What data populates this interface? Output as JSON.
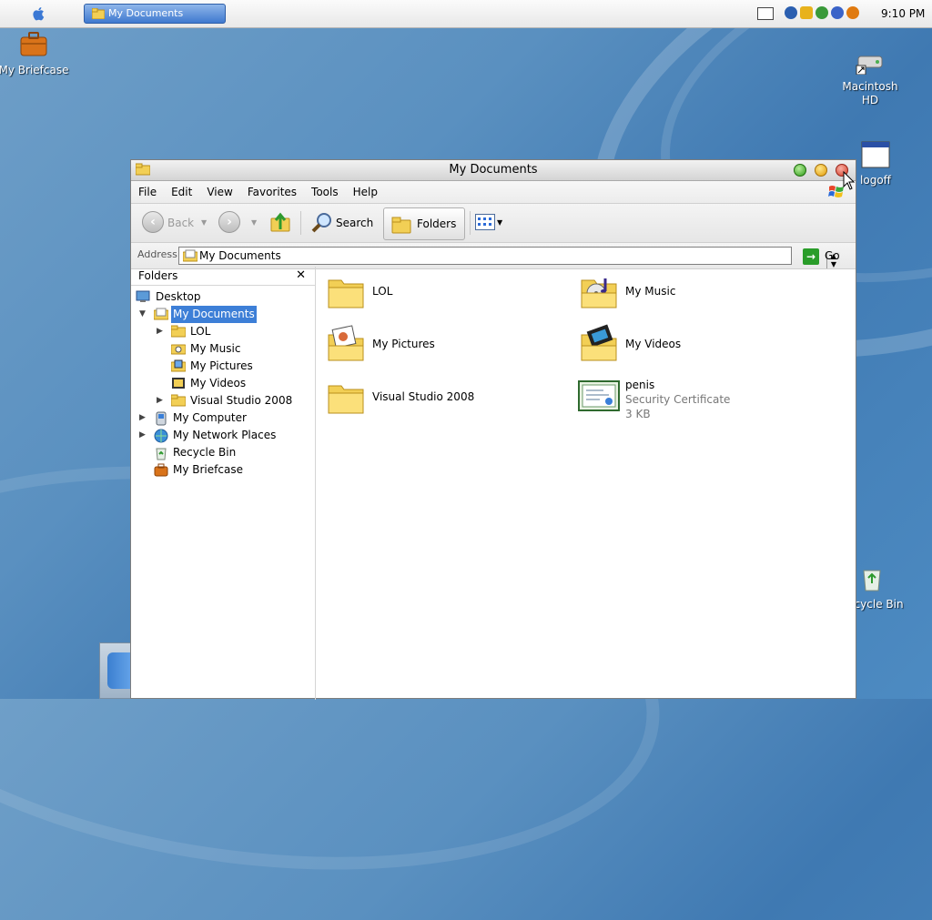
{
  "menubar": {
    "task_button": "My Documents",
    "clock": "9:10 PM"
  },
  "desktop_icons": {
    "briefcase": "My Briefcase",
    "macintosh_hd": "Macintosh HD",
    "logoff": "logoff",
    "recycle_bin": "Recycle Bin"
  },
  "window": {
    "title": "My Documents",
    "menu": [
      "File",
      "Edit",
      "View",
      "Favorites",
      "Tools",
      "Help"
    ],
    "toolbar": {
      "back": "Back",
      "search": "Search",
      "folders": "Folders"
    },
    "address": {
      "label": "Address",
      "value": "My Documents",
      "go": "Go"
    },
    "folders_pane": {
      "title": "Folders",
      "tree": [
        {
          "label": "Desktop"
        },
        {
          "label": "My Documents"
        },
        {
          "label": "LOL"
        },
        {
          "label": "My Music"
        },
        {
          "label": "My Pictures"
        },
        {
          "label": "My Videos"
        },
        {
          "label": "Visual Studio 2008"
        },
        {
          "label": "My Computer"
        },
        {
          "label": "My Network Places"
        },
        {
          "label": "Recycle Bin"
        },
        {
          "label": "My Briefcase"
        }
      ]
    },
    "files": [
      {
        "name": "LOL"
      },
      {
        "name": "My Music"
      },
      {
        "name": "My Pictures"
      },
      {
        "name": "My Videos"
      },
      {
        "name": "Visual Studio 2008"
      },
      {
        "name": "penis",
        "type": "Security Certificate",
        "size": "3 KB"
      }
    ]
  },
  "colors": {
    "selection": "#3d7fd7",
    "folder": "#f2cf55",
    "desktop": "#4d8bc2"
  }
}
